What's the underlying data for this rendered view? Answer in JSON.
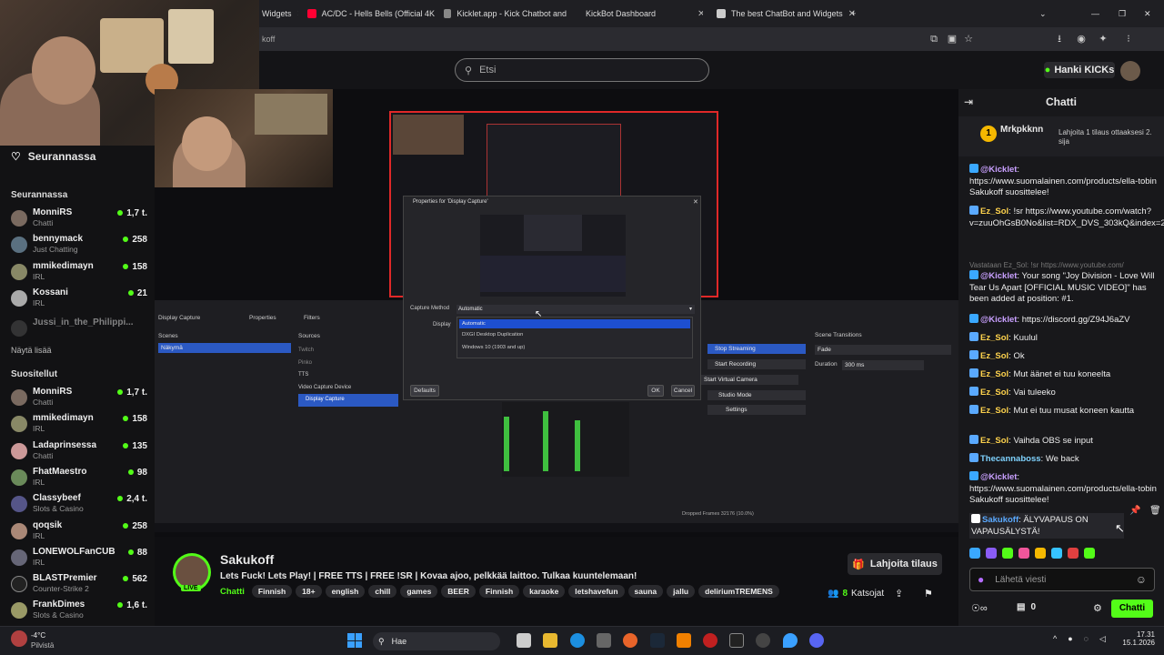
{
  "browser": {
    "tabs": [
      {
        "label": "Widgets",
        "color": "#5a7"
      },
      {
        "label": "AC/DC - Hells Bells (Official 4K",
        "color": "#f03"
      },
      {
        "label": "Kicklet.app - Kick Chatbot and",
        "color": "#888"
      },
      {
        "label": "KickBot Dashboard",
        "color": "#53fc18"
      },
      {
        "label": "The best ChatBot and Widgets",
        "color": "#ccc"
      }
    ],
    "address_text": "koff"
  },
  "header": {
    "search_placeholder": "Etsi",
    "kicks_label": "Hanki KICKs"
  },
  "sidebar": {
    "follow_title": "Seurannassa",
    "following_header": "Seurannassa",
    "following": [
      {
        "name": "MonniRS",
        "category": "Chatti",
        "count": "1,7 t."
      },
      {
        "name": "bennymack",
        "category": "Just Chatting",
        "count": "258"
      },
      {
        "name": "mmikedimayn",
        "category": "IRL",
        "count": "158"
      },
      {
        "name": "Kossani",
        "category": "IRL",
        "count": "21"
      },
      {
        "name": "Jussi_in_the_Philippi...",
        "category": "",
        "count": ""
      }
    ],
    "show_more": "Näytä lisää",
    "recommended_header": "Suositellut",
    "recommended": [
      {
        "name": "MonniRS",
        "category": "Chatti",
        "count": "1,7 t."
      },
      {
        "name": "mmikedimayn",
        "category": "IRL",
        "count": "158"
      },
      {
        "name": "Ladaprinsessa",
        "category": "Chatti",
        "count": "135"
      },
      {
        "name": "FhatMaestro",
        "category": "IRL",
        "count": "98"
      },
      {
        "name": "Classybeef",
        "category": "Slots & Casino",
        "count": "2,4 t."
      },
      {
        "name": "qoqsik",
        "category": "IRL",
        "count": "258"
      },
      {
        "name": "LONEWOLFanCUB",
        "category": "IRL",
        "count": "88"
      },
      {
        "name": "BLASTPremier",
        "category": "Counter-Strike 2",
        "count": "562"
      },
      {
        "name": "FrankDimes",
        "category": "Slots & Casino",
        "count": "1,6 t."
      }
    ]
  },
  "obs": {
    "dialog_title": "Properties for 'Display Capture'",
    "capture_method_label": "Capture Method",
    "capture_method_value": "Automatic",
    "display_label": "Display",
    "options": [
      "Automatic",
      "DXGI Desktop Duplication",
      "Windows 10 (1903 and up)"
    ],
    "defaults_btn": "Defaults",
    "ok_btn": "OK",
    "cancel_btn": "Cancel",
    "scenes_label": "Scenes",
    "scene_item": "Näkymä",
    "sources_label": "Sources",
    "sources": [
      "Twitch",
      "Pinko",
      "TTS",
      "Video Capture Device",
      "Display Capture"
    ],
    "controls": [
      "Stop Streaming",
      "Start Recording",
      "Start Virtual Camera",
      "Studio Mode",
      "Settings"
    ],
    "transitions_label": "Scene Transitions",
    "transition": "Fade",
    "duration_label": "Duration",
    "duration": "300 ms",
    "display_capture_tab": "Display Capture",
    "properties_tab": "Properties",
    "filters_tab": "Filters",
    "status": "Dropped Frames 32176 (10.0%)"
  },
  "chat": {
    "title": "Chatti",
    "gift_user": "Mrkpkknn",
    "gift_text": "Lahjoita 1 tilaus ottaaksesi 2. sija",
    "messages": [
      {
        "user": "@Kicklet",
        "color": "#c9a0ff",
        "text": "https://www.suomalainen.com/products/ella-tobin Sakukoff suosittelee!"
      },
      {
        "user": "Ez_Sol",
        "color": "#ffd34d",
        "text": "!sr https://www.youtube.com/watch?v=zuuOhGsB0No&list=RDX_DVS_303kQ&index=27"
      },
      {
        "user": "@Kicklet",
        "color": "#c9a0ff",
        "text": "Your song \"Joy Division - Love Will Tear Us Apart [OFFICIAL MUSIC VIDEO]\" has been added at position: #1."
      },
      {
        "user": "@Kicklet",
        "color": "#c9a0ff",
        "text": "https://discord.gg/Z94J6aZV"
      },
      {
        "user": "Ez_Sol",
        "color": "#ffd34d",
        "text": "Kuulul"
      },
      {
        "user": "Ez_Sol",
        "color": "#ffd34d",
        "text": "Ok"
      },
      {
        "user": "Ez_Sol",
        "color": "#ffd34d",
        "text": "Mut äänet ei tuu koneelta"
      },
      {
        "user": "Ez_Sol",
        "color": "#ffd34d",
        "text": "Vai tuleeko"
      },
      {
        "user": "Ez_Sol",
        "color": "#ffd34d",
        "text": "Mut ei tuu musat koneen kautta"
      },
      {
        "user": "Ez_Sol",
        "color": "#ffd34d",
        "text": "Vaihda OBS se input"
      },
      {
        "user": "Thecannaboss",
        "color": "#7fd3ff",
        "text": "We back"
      },
      {
        "user": "@Kicklet",
        "color": "#c9a0ff",
        "text": "https://www.suomalainen.com/products/ella-tobin Sakukoff suosittelee!"
      },
      {
        "user": "Sakukoff",
        "color": "#5aa9ff",
        "text": "ÄLYVAPAUS ON VAPAUSÄLYSTÄ!"
      }
    ],
    "reply_hint": "Vastataan Ez_Sol: !sr https://www.youtube.com/",
    "input_placeholder": "Lähetä viesti",
    "points": "0",
    "send_label": "Chatti"
  },
  "stream": {
    "streamer": "Sakukoff",
    "title": "Lets Fuck! Lets Play! | FREE TTS | FREE !SR | Kovaa ajoo, pelkkää laittoo. Tulkaa kuuntelemaan!",
    "category": "Chatti",
    "tags": [
      "Finnish",
      "18+",
      "english",
      "chill",
      "games",
      "BEER",
      "Finnish",
      "karaoke",
      "letshavefun",
      "sauna",
      "jallu",
      "deliriumTREMENS"
    ],
    "viewers": "8",
    "viewers_label": "Katsojat",
    "sub_button": "Lahjoita tilaus",
    "live_badge": "LIVE"
  },
  "taskbar": {
    "weather": "-4°C",
    "weather_sub": "Pilvistä",
    "search": "Hae",
    "time": "17.31",
    "date": "15.1.2026"
  }
}
